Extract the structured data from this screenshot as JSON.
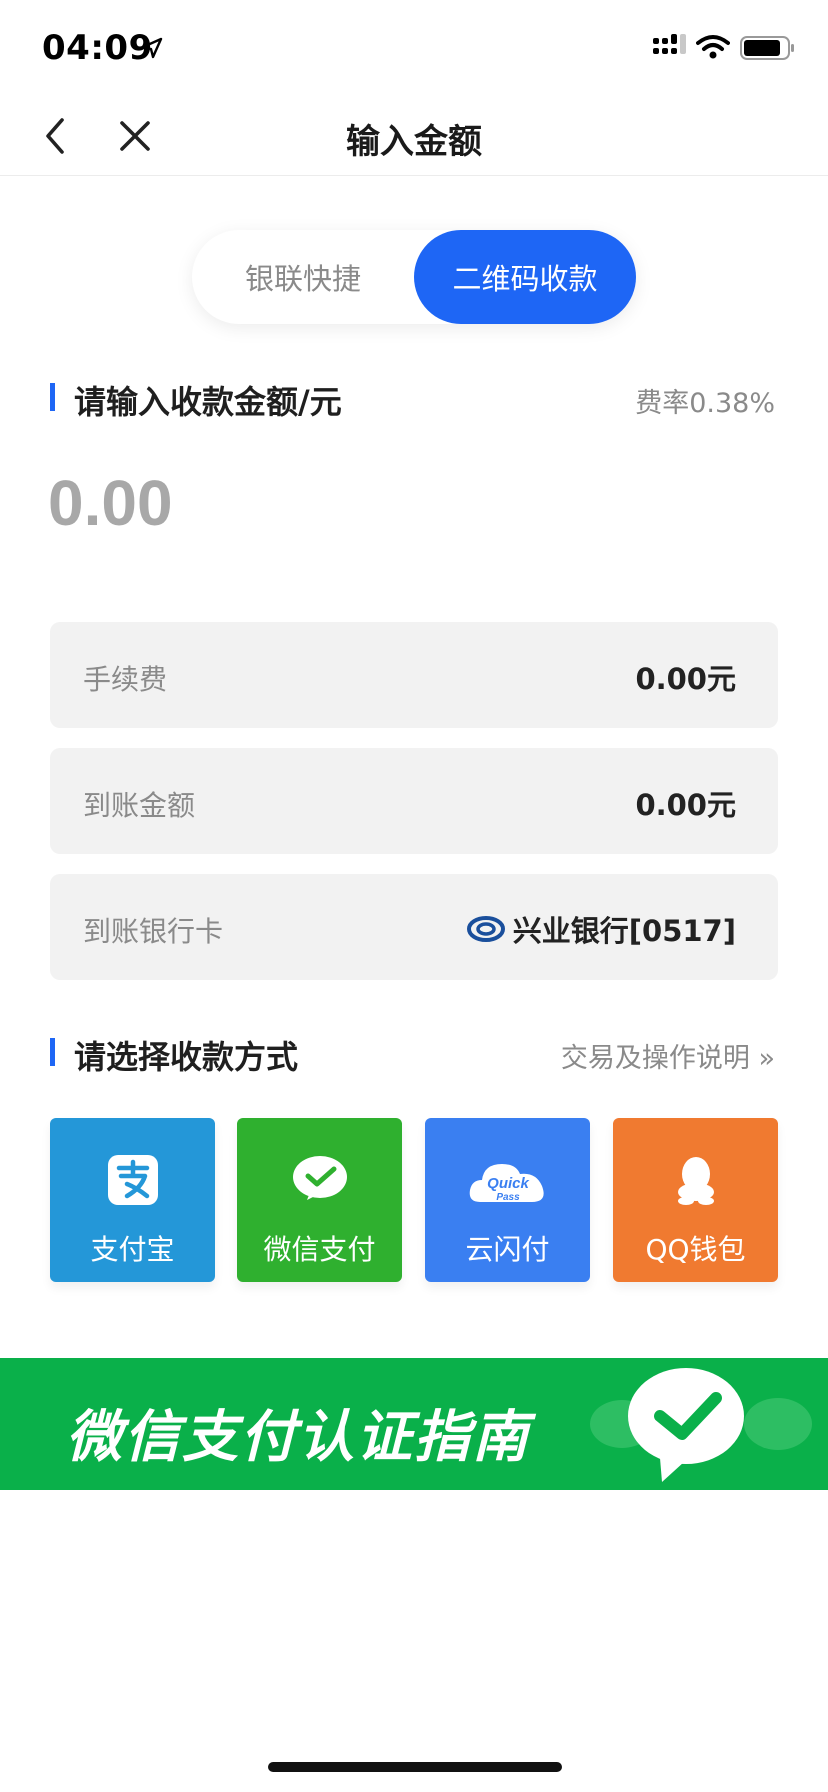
{
  "status_bar": {
    "time": "04:09"
  },
  "nav": {
    "title": "输入金额"
  },
  "segmented": {
    "left_label": "银联快捷",
    "right_label": "二维码收款",
    "active": "right"
  },
  "amount_section": {
    "title": "请输入收款金额/元",
    "fee_rate": "费率0.38%",
    "amount": "0.00"
  },
  "info_rows": {
    "fee": {
      "label": "手续费",
      "value": "0.00元"
    },
    "received": {
      "label": "到账金额",
      "value": "0.00元"
    },
    "bank_card": {
      "label": "到账银行卡",
      "value": "兴业银行[0517]"
    }
  },
  "method_section": {
    "title": "请选择收款方式",
    "link": "交易及操作说明 »"
  },
  "methods": [
    {
      "label": "支付宝",
      "color": "#2497d8",
      "icon": "alipay-icon"
    },
    {
      "label": "微信支付",
      "color": "#2fb02f",
      "icon": "wechat-icon"
    },
    {
      "label": "云闪付",
      "color": "#3a7ff1",
      "icon": "quickpass-icon"
    },
    {
      "label": "QQ钱包",
      "color": "#f07a30",
      "icon": "qq-icon"
    }
  ],
  "banner": {
    "text": "微信支付认证指南",
    "color": "#0ab04a"
  },
  "colors": {
    "accent": "#1e66f5"
  }
}
